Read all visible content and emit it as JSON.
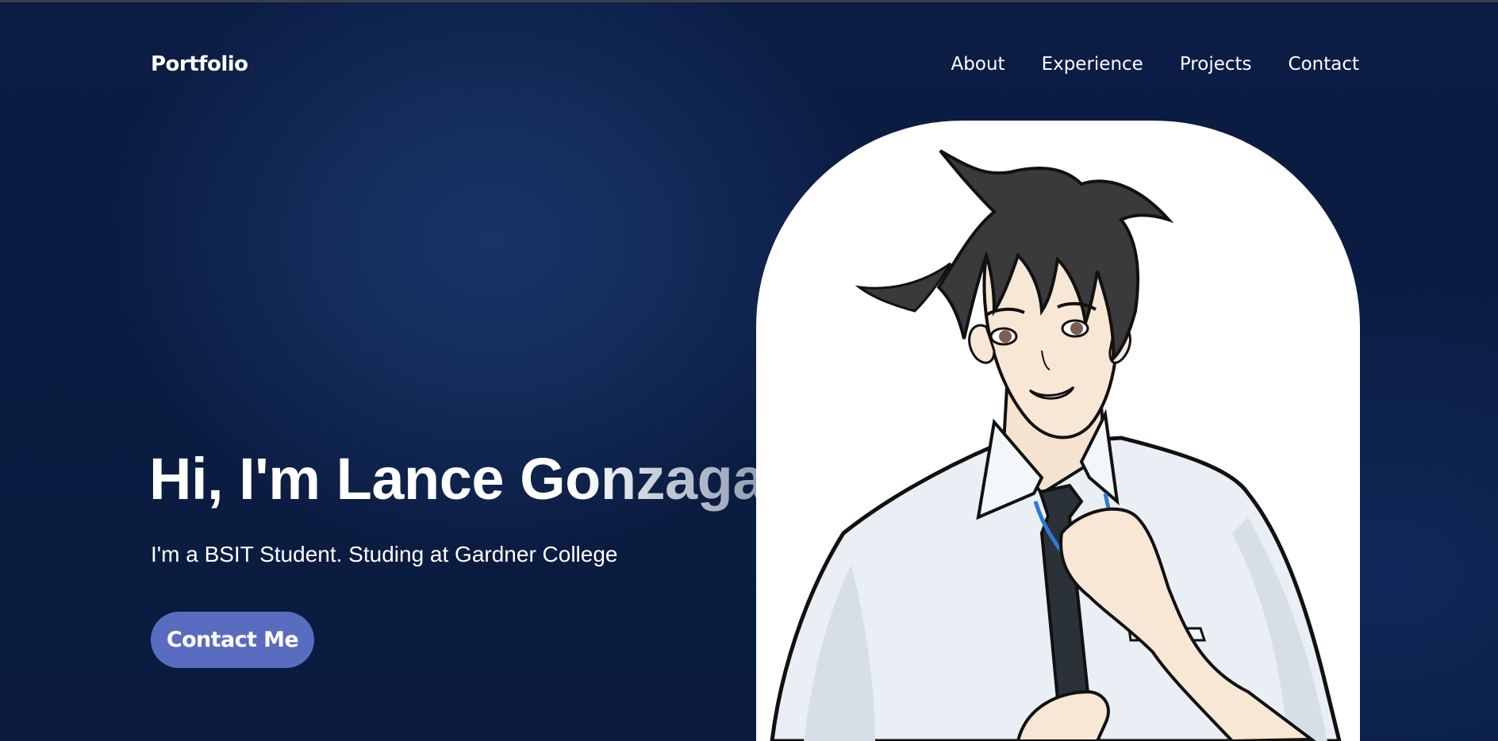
{
  "nav": {
    "brand": "Portfolio",
    "links": [
      "About",
      "Experience",
      "Projects",
      "Contact"
    ]
  },
  "hero": {
    "title": "Hi, I'm Lance Gonzaga",
    "subtitle": "I'm a BSIT Student. Studing at Gardner College",
    "cta_label": "Contact Me"
  },
  "portrait": {
    "subject": "anime-style boy in white shirt and tie"
  },
  "colors": {
    "background": "#0b1d44",
    "accent": "#5a6cc0",
    "text": "#ffffff"
  }
}
